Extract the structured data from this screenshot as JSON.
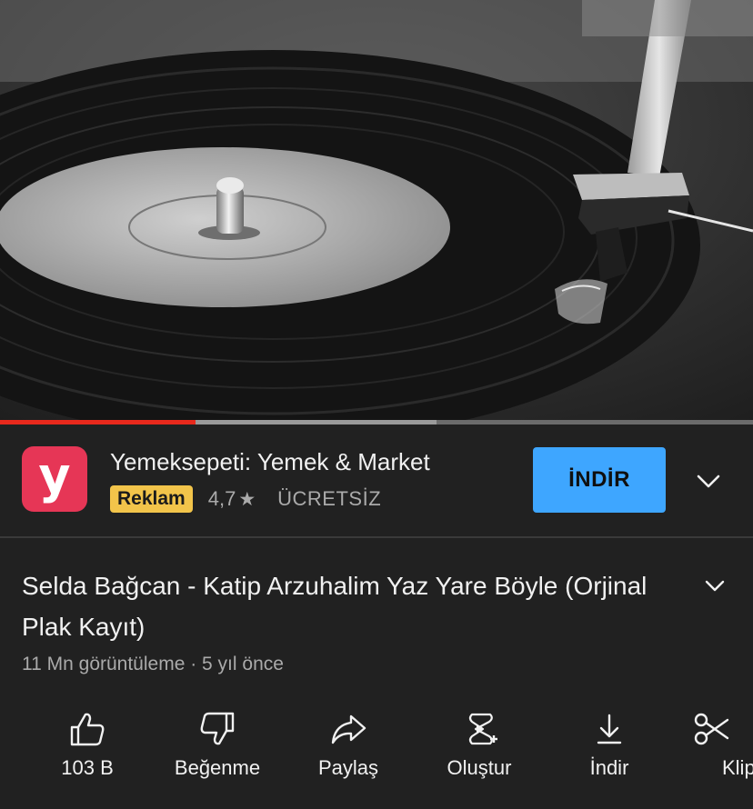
{
  "player": {
    "progress_played": 0.26,
    "progress_buffered": 0.58,
    "colors": {
      "played": "#e8291c",
      "buffered": "#9a9a9a",
      "track": "#6b6b6b"
    }
  },
  "ad": {
    "logo_letter": "y",
    "logo_color": "#e63656",
    "title": "Yemeksepeti: Yemek & Market",
    "badge": "Reklam",
    "rating": "4,7",
    "star": "★",
    "price": "ÜCRETSİZ",
    "install_label": "İNDİR",
    "install_color": "#3ea6ff",
    "expand_icon": "chevron-down-icon"
  },
  "video": {
    "title": "Selda Bağcan - Katip Arzuhalim Yaz Yare Böyle (Orjinal Plak Kayıt)",
    "meta": "11 Mn görüntüleme · 5 yıl önce",
    "expand_icon": "chevron-down-icon"
  },
  "actions": [
    {
      "label": "103 B",
      "icon": "thumbs-up-icon"
    },
    {
      "label": "Beğenme",
      "icon": "thumbs-down-icon"
    },
    {
      "label": "Paylaş",
      "icon": "share-icon"
    },
    {
      "label": "Oluştur",
      "icon": "remix-icon"
    },
    {
      "label": "İndir",
      "icon": "download-icon"
    },
    {
      "label": "Klip",
      "icon": "scissors-icon"
    }
  ]
}
